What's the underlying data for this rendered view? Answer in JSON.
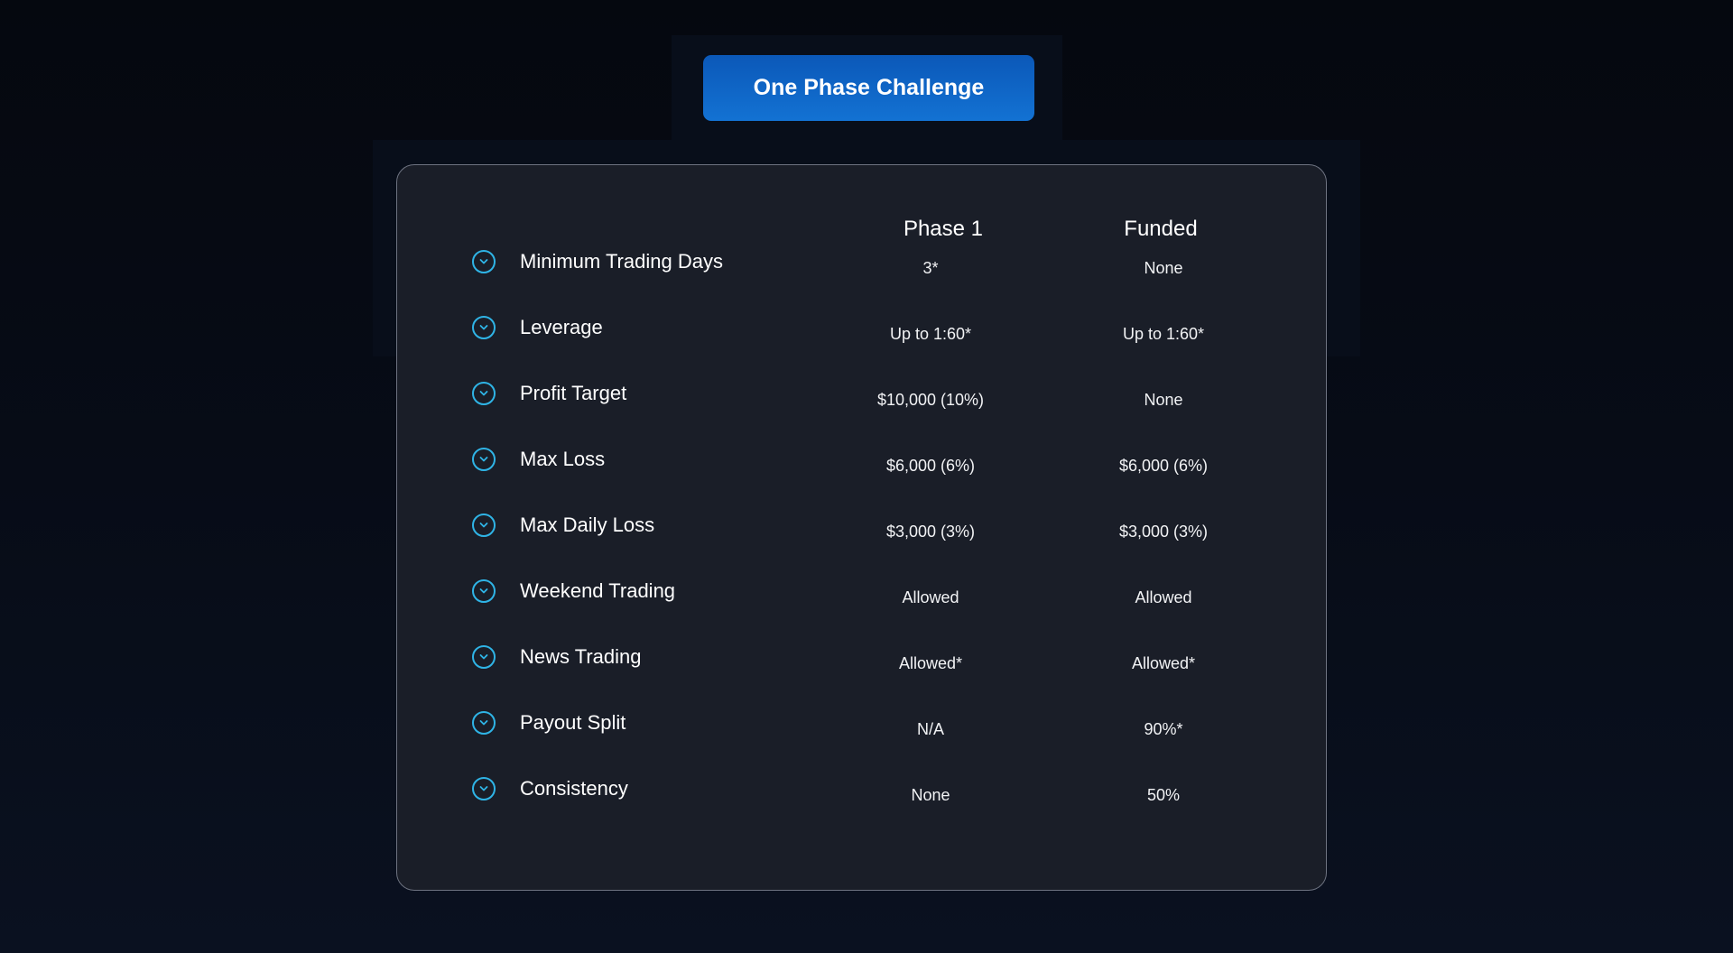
{
  "header": {
    "challenge_button_label": "One Phase Challenge"
  },
  "table": {
    "columns": [
      "Phase 1",
      "Funded"
    ],
    "rows": [
      {
        "label": "Minimum Trading Days",
        "phase1": "3*",
        "funded": "None"
      },
      {
        "label": "Leverage",
        "phase1": "Up to 1:60*",
        "funded": "Up to 1:60*"
      },
      {
        "label": "Profit Target",
        "phase1": "$10,000 (10%)",
        "funded": "None"
      },
      {
        "label": "Max Loss",
        "phase1": "$6,000 (6%)",
        "funded": "$6,000 (6%)"
      },
      {
        "label": "Max Daily Loss",
        "phase1": "$3,000 (3%)",
        "funded": "$3,000 (3%)"
      },
      {
        "label": "Weekend Trading",
        "phase1": "Allowed",
        "funded": "Allowed"
      },
      {
        "label": "News Trading",
        "phase1": "Allowed*",
        "funded": "Allowed*"
      },
      {
        "label": "Payout Split",
        "phase1": "N/A",
        "funded": "90%*"
      },
      {
        "label": "Consistency",
        "phase1": "None",
        "funded": "50%"
      }
    ],
    "row_icon": "chevron-down-circle-icon"
  },
  "colors": {
    "accent": "#2fb4e6",
    "button": "#0b62c4",
    "card_background": "#1a1e28",
    "card_border": "#6e7381",
    "page_background": "#05080f"
  }
}
